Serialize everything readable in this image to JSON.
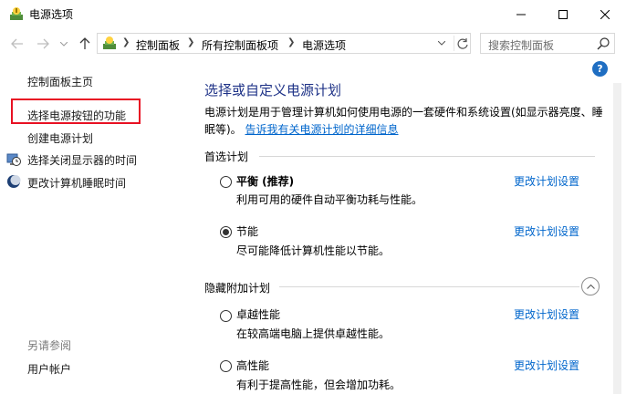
{
  "window": {
    "title": "电源选项",
    "icons": {
      "app": "power-options-icon",
      "minimize": "minimize-icon",
      "maximize": "maximize-icon",
      "close": "close-icon"
    }
  },
  "address_bar": {
    "breadcrumbs": [
      "控制面板",
      "所有控制面板项",
      "电源选项"
    ],
    "search_placeholder": "搜索控制面板",
    "icons": {
      "back": "arrow-left-icon",
      "forward": "arrow-right-icon",
      "up": "arrow-up-icon",
      "refresh": "refresh-icon",
      "search": "search-icon"
    }
  },
  "left_pane": {
    "home": "控制面板主页",
    "links": [
      {
        "label": "选择电源按钮的功能",
        "icon": null,
        "highlighted": true
      },
      {
        "label": "创建电源计划",
        "icon": null
      },
      {
        "label": "选择关闭显示器的时间",
        "icon": "monitor-clock-icon"
      },
      {
        "label": "更改计算机睡眠时间",
        "icon": "sleep-moon-icon"
      }
    ],
    "see_also": "另请参阅",
    "see_also_links": [
      "用户帐户"
    ],
    "highlight_color": "#e81123"
  },
  "main": {
    "title": "选择或自定义电源计划",
    "description": "电源计划是用于管理计算机如何使用电源的一套硬件和系统设置(如显示器亮度、睡眠等)。",
    "description_link": "告诉我有关电源计划的详细信息",
    "preferred_label": "首选计划",
    "hidden_label": "隐藏附加计划",
    "change_link": "更改计划设置",
    "plans": [
      {
        "name": "平衡 (推荐)",
        "desc": "利用可用的硬件自动平衡功耗与性能。",
        "selected": false
      },
      {
        "name": "节能",
        "desc": "尽可能降低计算机性能以节能。",
        "selected": true
      },
      {
        "name": "卓越性能",
        "desc": "在较高端电脑上提供卓越性能。",
        "selected": false
      },
      {
        "name": "高性能",
        "desc": "有利于提高性能，但会增加功耗。",
        "selected": false
      }
    ],
    "title_color": "#1e3287",
    "link_color": "#0066cc"
  }
}
